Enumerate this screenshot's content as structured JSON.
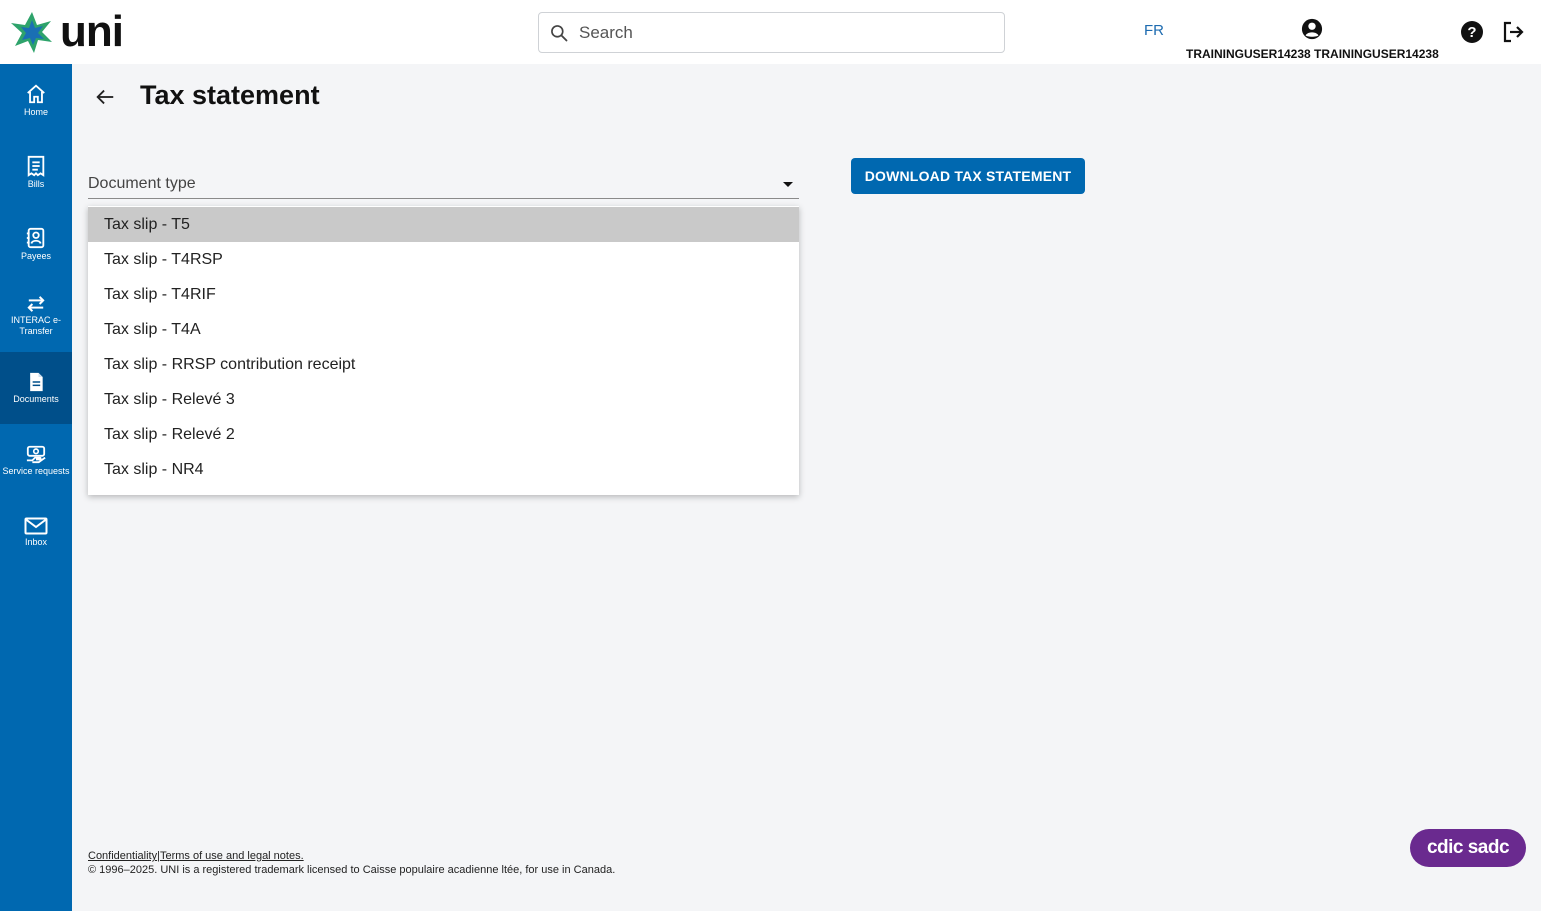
{
  "app": {
    "logo_text": "uni",
    "brand_colors": {
      "primary": "#0068b0",
      "active": "#004f8a",
      "logo_green": "#2ea36b",
      "logo_blue": "#1a6fb4",
      "cdic_purple": "#6a2a8f"
    }
  },
  "header": {
    "search_placeholder": "Search",
    "language_toggle": "FR",
    "user_name": "TRAININGUSER14238 TRAININGUSER14238",
    "icons": [
      "search-icon",
      "account-circle-icon",
      "help-icon",
      "logout-icon"
    ]
  },
  "sidebar": {
    "items": [
      {
        "label": "Home",
        "icon": "home-icon",
        "active": false
      },
      {
        "label": "Bills",
        "icon": "receipt-icon",
        "active": false
      },
      {
        "label": "Payees",
        "icon": "contacts-icon",
        "active": false
      },
      {
        "label": "INTERAC e-Transfer",
        "icon": "transfer-arrows-icon",
        "active": false
      },
      {
        "label": "Documents",
        "icon": "document-icon",
        "active": true
      },
      {
        "label": "Service requests",
        "icon": "service-request-icon",
        "active": false
      },
      {
        "label": "Inbox",
        "icon": "envelope-icon",
        "active": false
      }
    ]
  },
  "main": {
    "title": "Tax statement",
    "document_type_label": "Document type",
    "download_button": "DOWNLOAD TAX STATEMENT",
    "options": [
      "Tax slip - T5",
      "Tax slip - T4RSP",
      "Tax slip - T4RIF",
      "Tax slip - T4A",
      "Tax slip - RRSP contribution receipt",
      "Tax slip - Relevé 3",
      "Tax slip - Relevé 2",
      "Tax slip - NR4"
    ],
    "highlighted_option": "Tax slip - T5"
  },
  "footer": {
    "confidentiality_link": "Confidentiality",
    "separator": "|",
    "terms_link": "Terms of use and legal notes.",
    "copyright": "© 1996–2025. UNI is a registered trademark licensed to Caisse populaire acadienne ltée, for use in Canada.",
    "cdic_badge": "cdic sadc"
  }
}
